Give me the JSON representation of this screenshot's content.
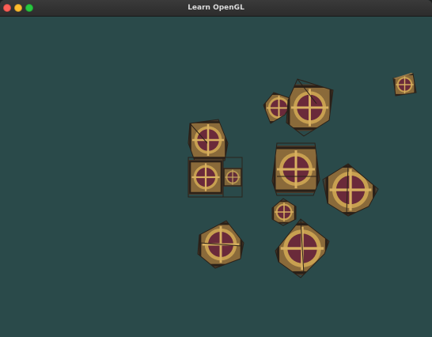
{
  "window": {
    "title": "Learn OpenGL",
    "traffic_lights": {
      "close_color": "#ff5f57",
      "minimize_color": "#febc2e",
      "maximize_color": "#28c840"
    }
  },
  "scene": {
    "clear_color": "#2a4a4a",
    "cube_texture_colors": {
      "wood": "#8a6a3a",
      "wood_dark": "#4a3a2a",
      "face_disc": "#6a2a3a",
      "band": "#c8a050"
    },
    "cube_count": 12
  }
}
